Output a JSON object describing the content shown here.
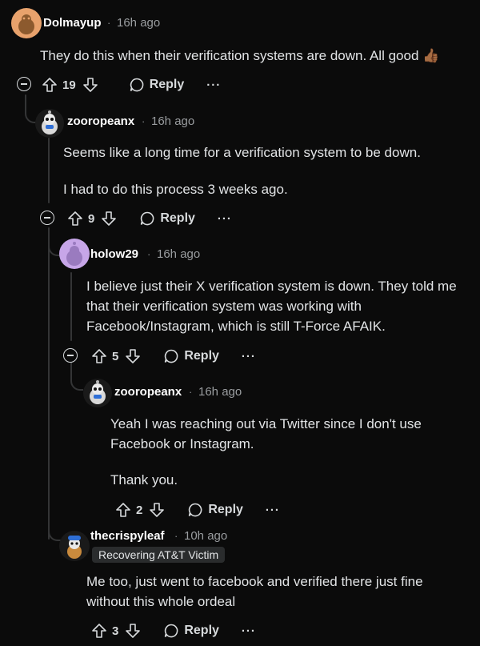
{
  "comments": [
    {
      "author": "Dolmayup",
      "separator": "·",
      "time": "16h ago",
      "body": [
        "They do this when their verification systems are down. All good 👍🏾"
      ],
      "score": "19",
      "reply_label": "Reply",
      "more": "···"
    },
    {
      "author": "zooropeanx",
      "separator": "·",
      "time": "16h ago",
      "body": [
        "Seems like a long time for a verification system to be down.",
        "I had to do this process 3 weeks ago."
      ],
      "score": "9",
      "reply_label": "Reply",
      "more": "···"
    },
    {
      "author": "holow29",
      "separator": "·",
      "time": "16h ago",
      "body": [
        "I believe just their X verification system is down. They told me that their verification system was working with Facebook/Instagram, which is still T-Force AFAIK."
      ],
      "score": "5",
      "reply_label": "Reply",
      "more": "···"
    },
    {
      "author": "zooropeanx",
      "separator": "·",
      "time": "16h ago",
      "body": [
        "Yeah I was reaching out via Twitter since I don't use Facebook or Instagram.",
        "Thank you."
      ],
      "score": "2",
      "reply_label": "Reply",
      "more": "···"
    },
    {
      "author": "thecrispyleaf",
      "separator": "·",
      "time": "10h ago",
      "flair": "Recovering AT&T Victim",
      "body": [
        "Me too, just went to facebook and verified there just fine without this whole ordeal"
      ],
      "score": "3",
      "reply_label": "Reply",
      "more": "···"
    }
  ],
  "colors": {
    "background": "#0b0b0b",
    "thread_line": "#343536",
    "text": "#e2e4e6",
    "meta": "#9a9da0",
    "avatar_orange": "#e8a26c",
    "avatar_purple": "#c7a6e8",
    "avatar_blue": "#2f6fd6"
  }
}
